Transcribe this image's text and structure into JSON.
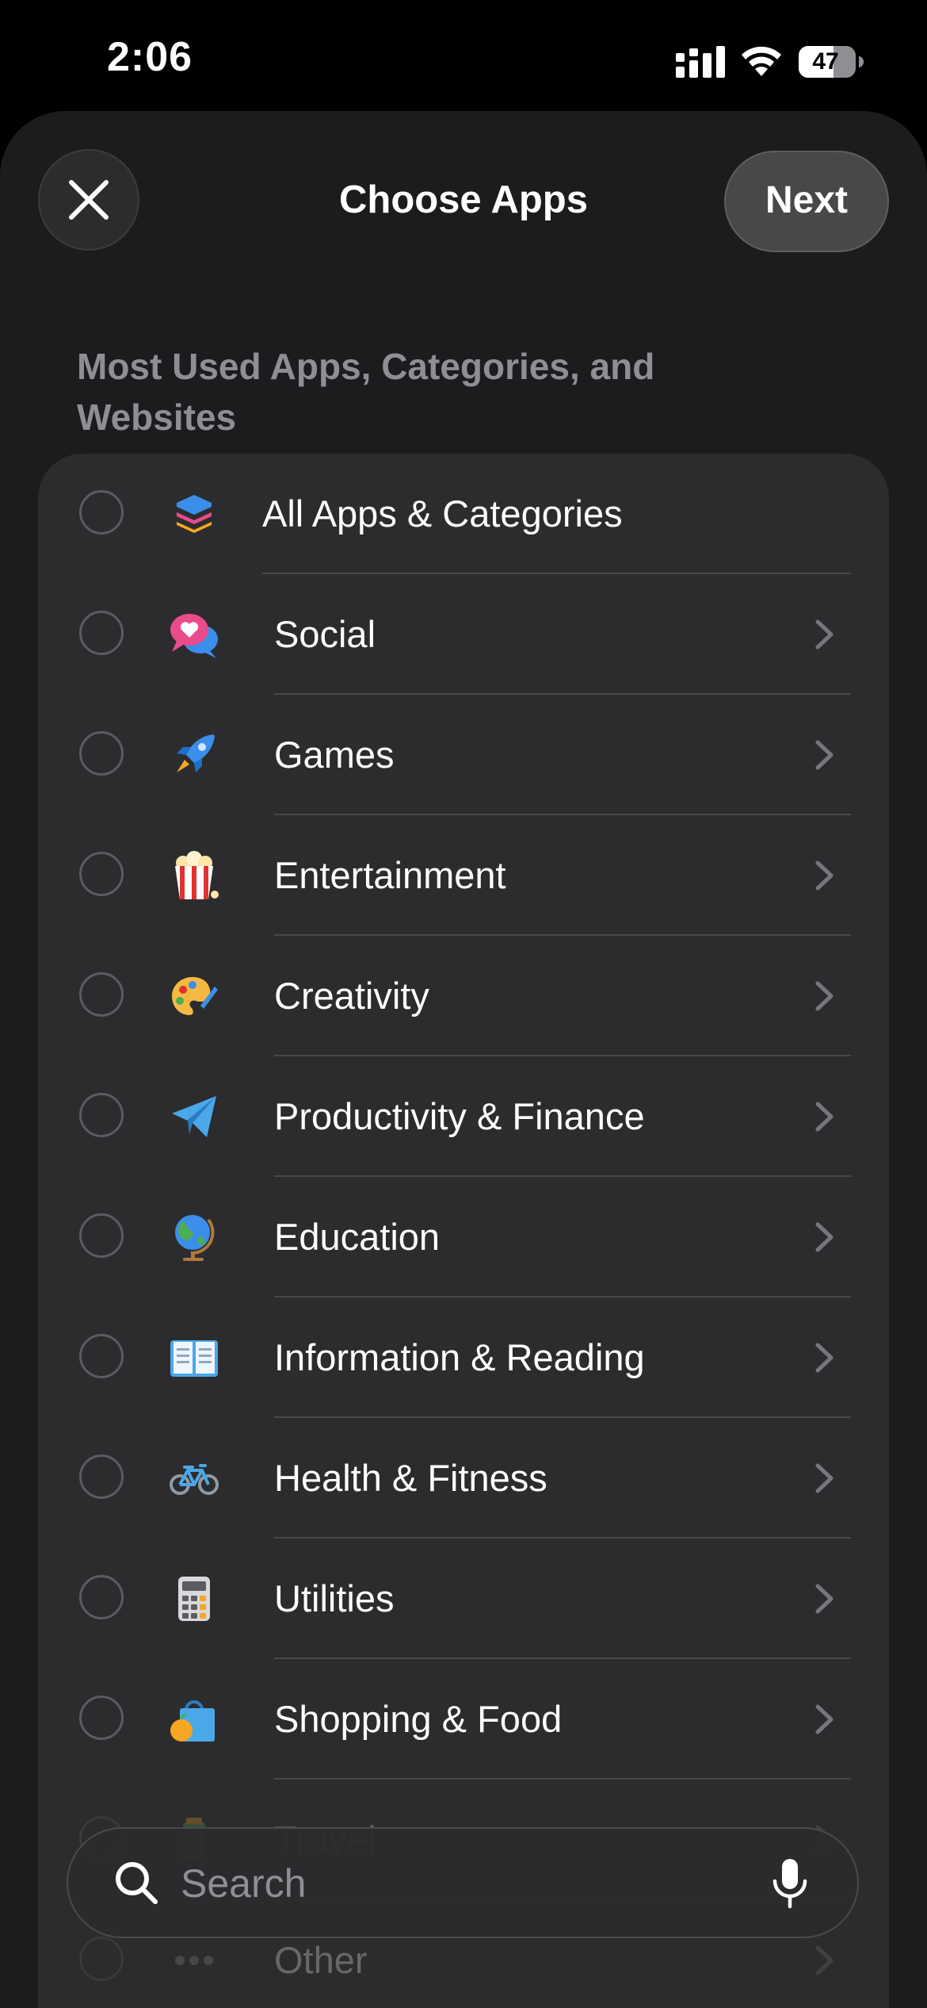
{
  "status_bar": {
    "time": "2:06",
    "battery": "47"
  },
  "header": {
    "title": "Choose Apps",
    "next_label": "Next"
  },
  "section_header": "Most Used Apps, Categories, and Websites",
  "rows": [
    {
      "label": "All Apps & Categories",
      "icon": "stack-icon"
    },
    {
      "label": "Social",
      "icon": "speech-bubbles-heart-icon"
    },
    {
      "label": "Games",
      "icon": "rocket-icon"
    },
    {
      "label": "Entertainment",
      "icon": "popcorn-icon"
    },
    {
      "label": "Creativity",
      "icon": "palette-icon"
    },
    {
      "label": "Productivity & Finance",
      "icon": "paper-plane-icon"
    },
    {
      "label": "Education",
      "icon": "globe-icon"
    },
    {
      "label": "Information & Reading",
      "icon": "open-book-icon"
    },
    {
      "label": "Health & Fitness",
      "icon": "bicycle-icon"
    },
    {
      "label": "Utilities",
      "icon": "calculator-icon"
    },
    {
      "label": "Shopping & Food",
      "icon": "shopping-bag-icon"
    },
    {
      "label": "Travel",
      "icon": "travel-icon"
    },
    {
      "label": "Other",
      "icon": "ellipsis-icon"
    }
  ],
  "search": {
    "placeholder": "Search"
  },
  "colors": {
    "sheet": "#1c1c1e",
    "list": "#2c2c2e",
    "accent_blue": "#4aa8e8"
  }
}
